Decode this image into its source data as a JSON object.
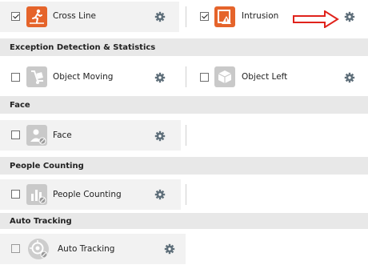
{
  "rows": {
    "cross_line": {
      "label": "Cross Line",
      "checked": true
    },
    "intrusion": {
      "label": "Intrusion",
      "checked": true
    }
  },
  "sections": {
    "exception": {
      "title": "Exception Detection & Statistics",
      "object_moving": {
        "label": "Object Moving",
        "checked": false
      },
      "object_left": {
        "label": "Object Left",
        "checked": false
      }
    },
    "face": {
      "title": "Face",
      "face_item": {
        "label": "Face",
        "checked": false
      }
    },
    "people_counting": {
      "title": "People Counting",
      "item": {
        "label": "People Counting",
        "checked": false
      }
    },
    "auto_tracking": {
      "title": "Auto Tracking",
      "item": {
        "label": "Auto Tracking",
        "checked": false,
        "disabled": true
      }
    }
  },
  "colors": {
    "header_bg": "#e8e8e8",
    "icon_orange": "#e5642b",
    "icon_grey": "#c9c9c9",
    "gear": "#5f6f7a",
    "arrow_red": "#e0231c"
  },
  "icons": {
    "cross_line": "running-person-icon",
    "intrusion": "intrusion-warning-icon",
    "object_moving": "hand-truck-icon",
    "object_left": "cube-icon",
    "face": "person-disabled-icon",
    "people_counting": "bar-chart-disabled-icon",
    "auto_tracking": "target-disabled-icon",
    "settings": "gear-icon",
    "pointer": "red-arrow-icon"
  }
}
